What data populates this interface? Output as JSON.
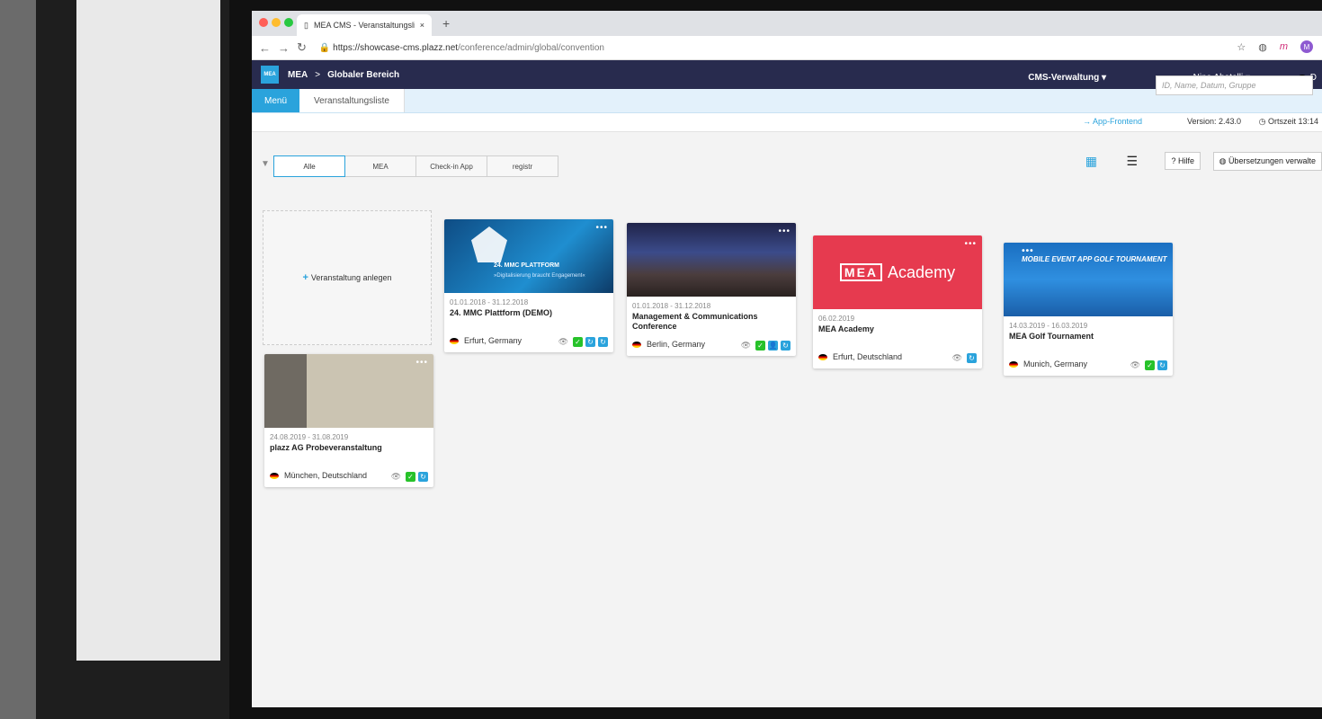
{
  "browser": {
    "tab_title": "MEA CMS - Veranstaltungsliste",
    "close": "×",
    "new_tab": "+",
    "url_main": "https://showcase-cms.plazz.net",
    "url_path": "/conference/admin/global/convention"
  },
  "header": {
    "logo": "MEA",
    "crumb1": "MEA",
    "crumb_sep": ">",
    "crumb2": "Globaler Bereich",
    "cms_menu": "CMS-Verwaltung ▾",
    "user": "Nina Abatelli ▾",
    "lang": "D"
  },
  "subnav": {
    "menu": "Menü",
    "breadcrumb": "Veranstaltungsliste"
  },
  "infobar": {
    "app_frontend": "→ App-Frontend",
    "version": "Version: 2.43.0",
    "local_time": "Ortszeit 13:14"
  },
  "filters": [
    "Alle",
    "MEA",
    "Check-in App",
    "registr"
  ],
  "toolbar": {
    "help": "Hilfe",
    "translations": "Übersetzungen verwalte",
    "search_placeholder": "ID, Name, Datum, Gruppe"
  },
  "add_card": {
    "label": "Veranstaltung anlegen"
  },
  "events": [
    {
      "dates": "01.01.2018 - 31.12.2018",
      "name": "24. MMC Plattform (DEMO)",
      "location": "Erfurt, Germany",
      "image_title": "24. MMC PLATTFORM",
      "image_sub": "»Digitalisierung braucht Engagement«"
    },
    {
      "dates": "01.01.2018 - 31.12.2018",
      "name": "Management & Communications Conference",
      "location": "Berlin, Germany"
    },
    {
      "dates": "06.02.2019",
      "name": "MEA Academy",
      "location": "Erfurt, Deutschland",
      "image_logo": "MEA",
      "image_title": "Academy"
    },
    {
      "dates": "14.03.2019 - 16.03.2019",
      "name": "MEA Golf Tournament",
      "location": "Munich, Germany",
      "image_title": "MOBILE EVENT APP GOLF TOURNAMENT"
    },
    {
      "dates": "24.08.2019 - 31.08.2019",
      "name": "plazz AG Probeveranstaltung",
      "location": "München, Deutschland"
    }
  ]
}
